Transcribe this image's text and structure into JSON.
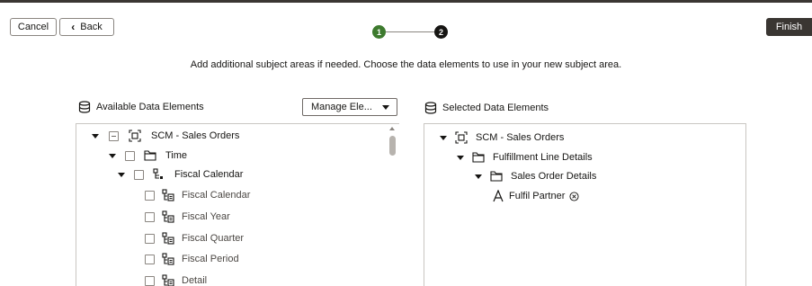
{
  "toolbar": {
    "cancel_label": "Cancel",
    "back_label": "Back",
    "finish_label": "Finish"
  },
  "stepper": {
    "step1": "1",
    "step2": "2",
    "current_step": 2
  },
  "instruction": "Add additional subject areas if needed. Choose the data elements to use in your new subject area.",
  "available": {
    "title": "Available Data Elements",
    "manage_label": "Manage Ele...",
    "tree": {
      "root": "SCM - Sales Orders",
      "time": "Time",
      "fiscal_calendar": "Fiscal Calendar",
      "children": [
        "Fiscal Calendar",
        "Fiscal Year",
        "Fiscal Quarter",
        "Fiscal Period",
        "Detail"
      ]
    }
  },
  "selected": {
    "title": "Selected Data Elements",
    "tree": {
      "root": "SCM - Sales Orders",
      "folder1": "Fulfillment Line Details",
      "folder2": "Sales Order Details",
      "attribute": "Fulfil Partner"
    }
  },
  "colors": {
    "accent_dark": "#3a3632",
    "step_done": "#3d7a2e",
    "step_current": "#161513"
  }
}
